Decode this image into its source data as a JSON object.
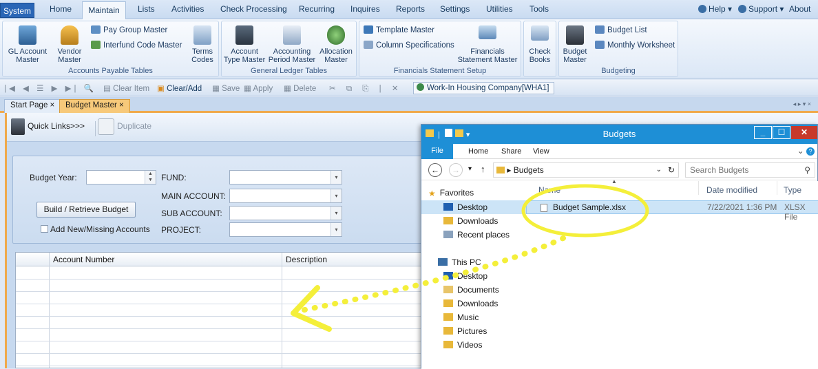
{
  "menubar": {
    "items": [
      "System",
      "Home",
      "Maintain",
      "Lists",
      "Activities",
      "Check Processing",
      "Recurring",
      "Inquires",
      "Reports",
      "Settings",
      "Utilities",
      "Tools"
    ],
    "right": {
      "help": "Help",
      "support": "Support",
      "about": "About"
    }
  },
  "ribbon": {
    "gl_account_master": "GL Account\nMaster",
    "vendor_master": "Vendor\nMaster",
    "pay_group_master": "Pay Group Master",
    "interfund_code_master": "Interfund Code Master",
    "terms_codes": "Terms\nCodes",
    "accounts_payable_tables": "Accounts Payable Tables",
    "account_type_master": "Account\nType Master",
    "accounting_period_master": "Accounting\nPeriod Master",
    "allocation_master": "Allocation\nMaster",
    "general_ledger_tables": "General Ledger Tables",
    "template_master": "Template Master",
    "column_specifications": "Column Specifications",
    "financials_statement_master": "Financials\nStatement Master",
    "financials_statement_setup": "Financials Statement Setup",
    "check_books": "Check\nBooks",
    "budget_master": "Budget\nMaster",
    "budget_list": "Budget List",
    "monthly_worksheet": "Monthly Worksheet",
    "budgeting": "Budgeting"
  },
  "toolbar": {
    "clear_item": "Clear Item",
    "clear_add": "Clear/Add",
    "save": "Save",
    "apply": "Apply",
    "delete": "Delete",
    "company": "Work-In Housing Company[WHA1]"
  },
  "tabs": [
    {
      "label": "Start Page"
    },
    {
      "label": "Budget Master"
    }
  ],
  "docbar": {
    "quick_links": "Quick Links>>>",
    "duplicate": "Duplicate"
  },
  "form": {
    "budget_year": "Budget Year:",
    "fund": "FUND:",
    "main_account": "MAIN ACCOUNT:",
    "sub_account": "SUB ACCOUNT:",
    "project": "PROJECT:",
    "build_retrieve": "Build / Retrieve Budget",
    "add_new_missing": "Add New/Missing Accounts"
  },
  "grid": {
    "columns": [
      "Account Number",
      "Description"
    ]
  },
  "explorer": {
    "title": "Budgets",
    "ribbon_tabs": [
      "File",
      "Home",
      "Share",
      "View"
    ],
    "path": "Budgets",
    "search_placeholder": "Search Budgets",
    "nav": {
      "favorites": "Favorites",
      "fav_items": [
        "Desktop",
        "Downloads",
        "Recent places"
      ],
      "this_pc": "This PC",
      "pc_items": [
        "Desktop",
        "Documents",
        "Downloads",
        "Music",
        "Pictures",
        "Videos"
      ]
    },
    "columns": {
      "name": "Name",
      "date": "Date modified",
      "type": "Type"
    },
    "file": {
      "name": "Budget Sample.xlsx",
      "date": "7/22/2021 1:36 PM",
      "type": "XLSX File"
    }
  },
  "colors": {
    "accent_orange": "#f0a94a",
    "highlight_yellow": "#f4ef3a",
    "explorer_blue": "#1e8fd6"
  }
}
